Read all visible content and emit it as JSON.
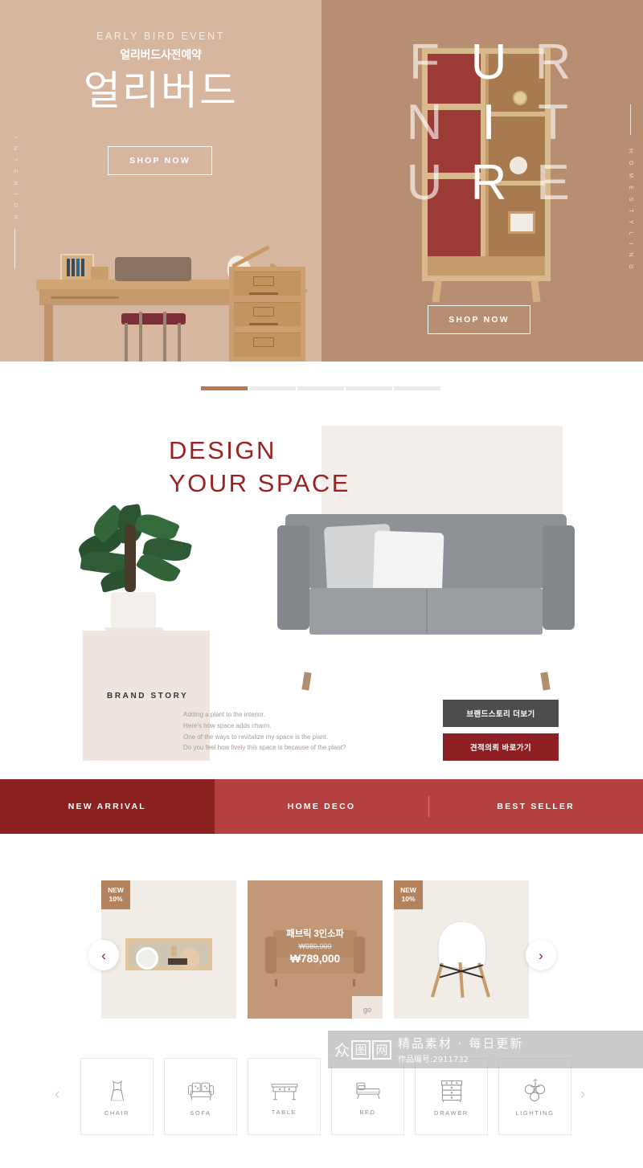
{
  "hero": {
    "left": {
      "side_label": "I N T E R I O R",
      "eyebrow": "EARLY BIRD EVENT",
      "korean_sub": "얼리버드사전예약",
      "korean_title": "얼리버드",
      "cta": "SHOP NOW",
      "bg_color": "#d6b69f"
    },
    "right": {
      "side_label": "H O M E   S T Y L I N G",
      "display_letters": [
        "F",
        "U",
        "R",
        "N",
        "I",
        "T",
        "U",
        "R",
        "E"
      ],
      "display_word": "FURNITURE",
      "cta": "SHOP NOW",
      "bg_color": "#b88e72"
    }
  },
  "slider": {
    "total": 5,
    "active_index": 0,
    "active_color": "#b9784f",
    "inactive_color": "#efe9e5"
  },
  "design": {
    "title_line1": "DESIGN",
    "title_line2": "YOUR SPACE",
    "title_color": "#9c2122",
    "brand_label": "BRAND STORY",
    "brand_copy": [
      "Adding a plant to the interior.",
      "Here's how space adds charm.",
      "One of the ways to revitalize my space is the plant.",
      "Do you feel how lively this space is because of the plant?"
    ],
    "cta_primary": "브랜드스토리 더보기",
    "cta_secondary": "견적의뢰 바로가기",
    "cta_primary_color": "#4d4d4d",
    "cta_secondary_color": "#8e1f22"
  },
  "tabs": [
    {
      "label": "NEW ARRIVAL",
      "active": true
    },
    {
      "label": "HOME DECO",
      "active": false
    },
    {
      "label": "BEST SELLER",
      "active": false
    }
  ],
  "tabbar": {
    "bg_color": "#b4413f",
    "active_color": "#8b2220"
  },
  "products": {
    "prev_label": "‹",
    "next_label": "›",
    "items": [
      {
        "badge_line1": "NEW",
        "badge_line2": "10%",
        "name": "",
        "price_old": "",
        "price_new": "",
        "thumb": "radio-icon",
        "card_style": "beige"
      },
      {
        "badge_line1": "",
        "badge_line2": "",
        "name": "패브릭 3인소파",
        "price_old": "₩980,000",
        "price_new": "₩789,000",
        "go_label": "go",
        "thumb": "sofa-icon",
        "card_style": "tan"
      },
      {
        "badge_line1": "NEW",
        "badge_line2": "10%",
        "name": "",
        "price_old": "",
        "price_new": "",
        "thumb": "chair-icon",
        "card_style": "beige"
      }
    ]
  },
  "categories": {
    "prev_label": "‹",
    "next_label": "›",
    "items": [
      {
        "label": "CHAIR",
        "icon": "chair-icon"
      },
      {
        "label": "SOFA",
        "icon": "sofa-icon"
      },
      {
        "label": "TABLE",
        "icon": "table-icon"
      },
      {
        "label": "BED",
        "icon": "bed-icon"
      },
      {
        "label": "DRAWER",
        "icon": "drawer-icon"
      },
      {
        "label": "LIGHTING",
        "icon": "lighting-icon"
      }
    ]
  },
  "watermark": {
    "logo_chars": [
      "众",
      "图",
      "网"
    ],
    "main_text": "精品素材 · 每日更新",
    "sub_text": "作品编号:2911732"
  }
}
